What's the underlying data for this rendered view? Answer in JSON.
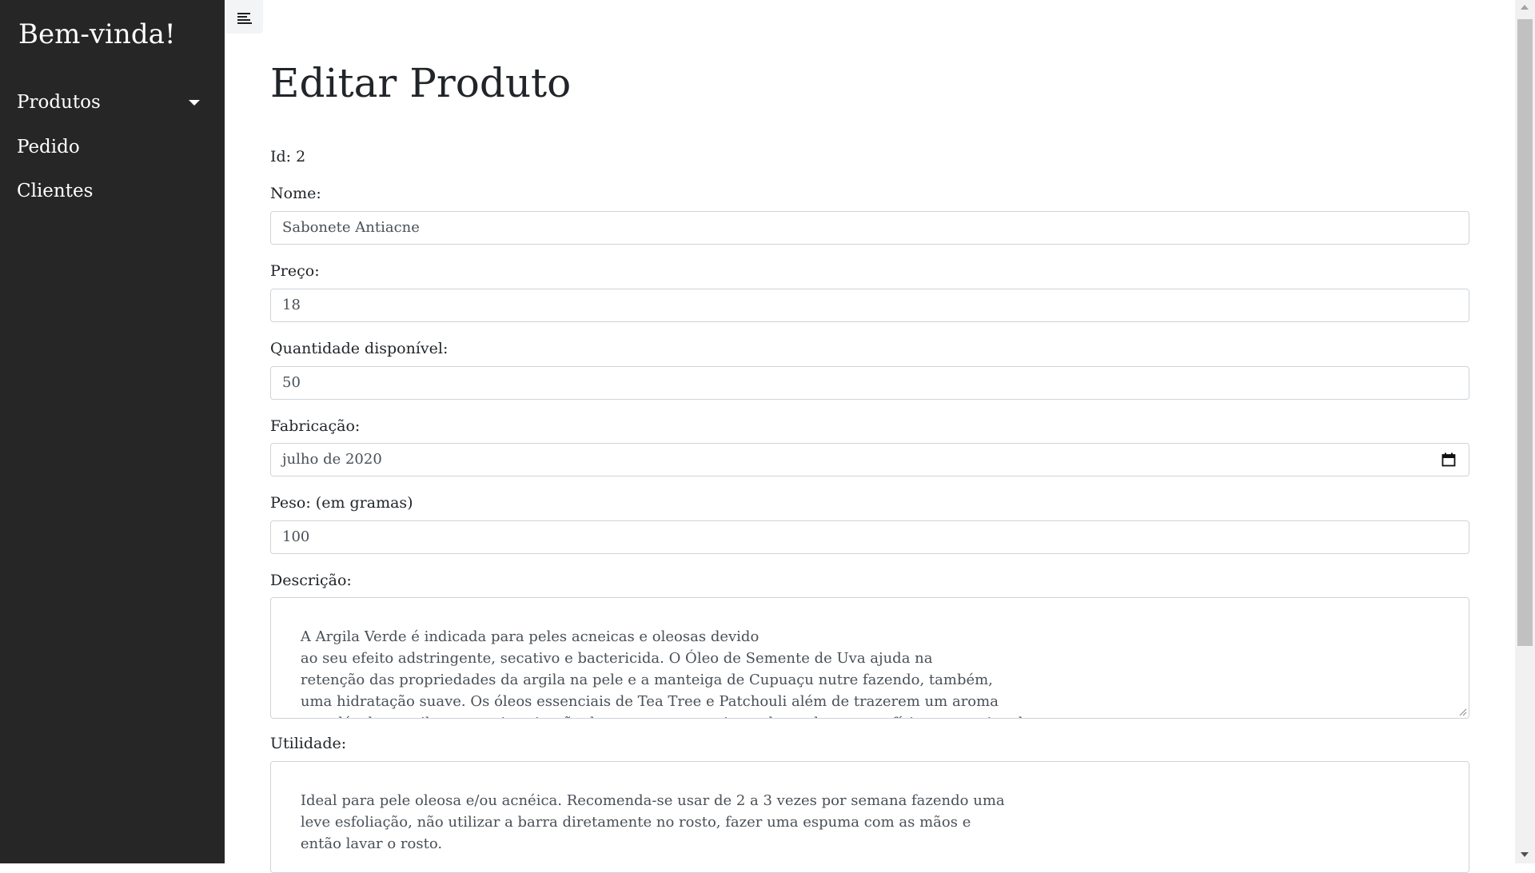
{
  "sidebar": {
    "brand": "Bem-vinda!",
    "items": [
      {
        "label": "Produtos",
        "has_dropdown": true
      },
      {
        "label": "Pedido"
      },
      {
        "label": "Clientes"
      }
    ],
    "background": "#262626"
  },
  "toolbar": {
    "toggle_icon": "menu-lines-icon"
  },
  "page": {
    "title": "Editar Produto",
    "id_text": "Id: 2"
  },
  "form": {
    "nome": {
      "label": "Nome:",
      "value": "Sabonete Antiacne"
    },
    "preco": {
      "label": "Preço:",
      "value": "18"
    },
    "quantidade": {
      "label": "Quantidade disponível:",
      "value": "50"
    },
    "fabricacao": {
      "label": "Fabricação:",
      "value": "julho de 2020",
      "icon": "calendar-icon"
    },
    "peso": {
      "label": "Peso: (em gramas)",
      "value": "100"
    },
    "descricao": {
      "label": "Descrição:",
      "value": "A Argila Verde é indicada para peles acneicas e oleosas devido\n    ao seu efeito adstringente, secativo e bactericida. O Óleo de Semente de Uva ajuda na\n    retenção das propriedades da argila na pele e a manteiga de Cupuaçu nutre fazendo, também,\n    uma hidratação suave. Os óleos essenciais de Tea Tree e Patchouli além de trazerem um aroma\n    agradável, contribuem na cicatrização das acnes, proporcionando um bem-estar físico e emocional."
    },
    "utilidade": {
      "label": "Utilidade:",
      "value": "Ideal para pele oleosa e/ou acnéica. Recomenda-se usar de 2 a 3 vezes por semana fazendo uma\n    leve esfoliação, não utilizar a barra diretamente no rosto, fazer uma espuma com as mãos e\n    então lavar o rosto."
    }
  }
}
